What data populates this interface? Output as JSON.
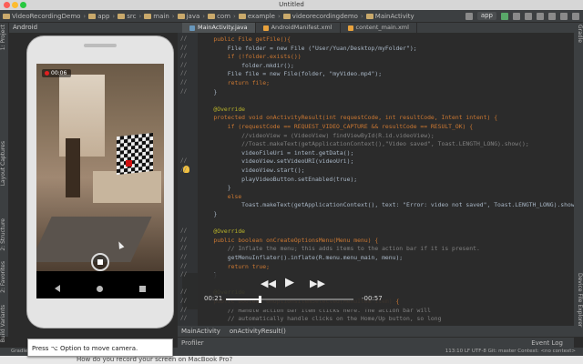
{
  "window": {
    "title": "Untitled"
  },
  "nav": {
    "crumbs": [
      "VideoRecordingDemo",
      "app",
      "src",
      "main",
      "java",
      "com",
      "example",
      "videorecordingdemo",
      "MainActivity"
    ],
    "app_selector": "app"
  },
  "project": {
    "label": "Android"
  },
  "left_tabs": [
    "1: Project",
    "Layout Captures",
    "2: Structure",
    "2: Favorites",
    "Build Variants"
  ],
  "right_tabs": [
    "Gradle",
    "Device File Explorer"
  ],
  "tabs": [
    {
      "label": "MainActivity.java",
      "color": "#6897bb"
    },
    {
      "label": "AndroidManifest.xml",
      "color": "#e8a23d"
    },
    {
      "label": "content_main.xml",
      "color": "#e8a23d"
    }
  ],
  "code_lines": [
    {
      "comment": "//",
      "text": "    public File getFile(){"
    },
    {
      "comment": "//",
      "text": "        File folder = new File (\"User/Yuan/Desktop/myFolder\");"
    },
    {
      "comment": "//",
      "text": "        if (!folder.exists())"
    },
    {
      "comment": "//",
      "text": "            folder.mkdir();"
    },
    {
      "comment": "//",
      "text": "        File file = new File(folder, \"myVideo.mp4\");"
    },
    {
      "comment": "//",
      "text": "        return file;"
    },
    {
      "comment": "//",
      "text": "    }"
    },
    {
      "comment": "",
      "text": ""
    },
    {
      "comment": "",
      "text": "    @Override"
    },
    {
      "comment": "",
      "text": "    protected void onActivityResult(int requestCode, int resultCode, Intent intent) {"
    },
    {
      "comment": "",
      "text": "        if (requestCode == REQUEST_VIDEO_CAPTURE && resultCode == RESULT_OK) {"
    },
    {
      "comment": "",
      "text": "            //videoView = (VideoView) findViewById(R.id.videoView);"
    },
    {
      "comment": "",
      "text": "            //Toast.makeText(getApplicationContext(),\"Video saved\", Toast.LENGTH_LONG).show();"
    },
    {
      "comment": "",
      "text": "            videoFileUri = intent.getData();"
    },
    {
      "comment": "//",
      "text": "            videoView.setVideoURI(videoUri);"
    },
    {
      "comment": "//",
      "text": "            videoView.start();"
    },
    {
      "comment": "",
      "text": "            playVideoButton.setEnabled(true);"
    },
    {
      "comment": "",
      "text": "        }"
    },
    {
      "comment": "",
      "text": "        else"
    },
    {
      "comment": "",
      "text": "            Toast.makeText(getApplicationContext(), text: \"Error: video not saved\", Toast.LENGTH_LONG).show();"
    },
    {
      "comment": "",
      "text": "    }"
    },
    {
      "comment": "",
      "text": ""
    },
    {
      "comment": "//",
      "text": "    @Override"
    },
    {
      "comment": "//",
      "text": "    public boolean onCreateOptionsMenu(Menu menu) {"
    },
    {
      "comment": "//",
      "text": "        // Inflate the menu; this adds items to the action bar if it is present."
    },
    {
      "comment": "//",
      "text": "        getMenuInflater().inflate(R.menu.menu_main, menu);"
    },
    {
      "comment": "//",
      "text": "        return true;"
    },
    {
      "comment": "//",
      "text": "    }"
    },
    {
      "comment": "",
      "text": ""
    },
    {
      "comment": "//",
      "text": "    @Override"
    },
    {
      "comment": "//",
      "text": "    public boolean onOptionsItemSelected(MenuItem item) {"
    },
    {
      "comment": "//",
      "text": "        // Handle action bar item clicks here. The action bar will"
    },
    {
      "comment": "//",
      "text": "        // automatically handle clicks on the Home/Up button, so long"
    }
  ],
  "breadcrumbs_bottom": [
    "MainActivity",
    "onActivityResult()"
  ],
  "bottom_tabs": {
    "profiler": "Profiler",
    "event_log": "Event Log"
  },
  "status": {
    "left": "Gradle",
    "right": "113:10  LF  UTF-8  Git: master  Context: <no context>"
  },
  "phone": {
    "rec_time": "00:06"
  },
  "video": {
    "elapsed": "00:21",
    "remaining": "-00:57",
    "progress": 0.26
  },
  "hint": {
    "text": "Press ⌥ Option to move camera."
  },
  "bottom_caption": "How do you record your screen on MacBook Pro?"
}
